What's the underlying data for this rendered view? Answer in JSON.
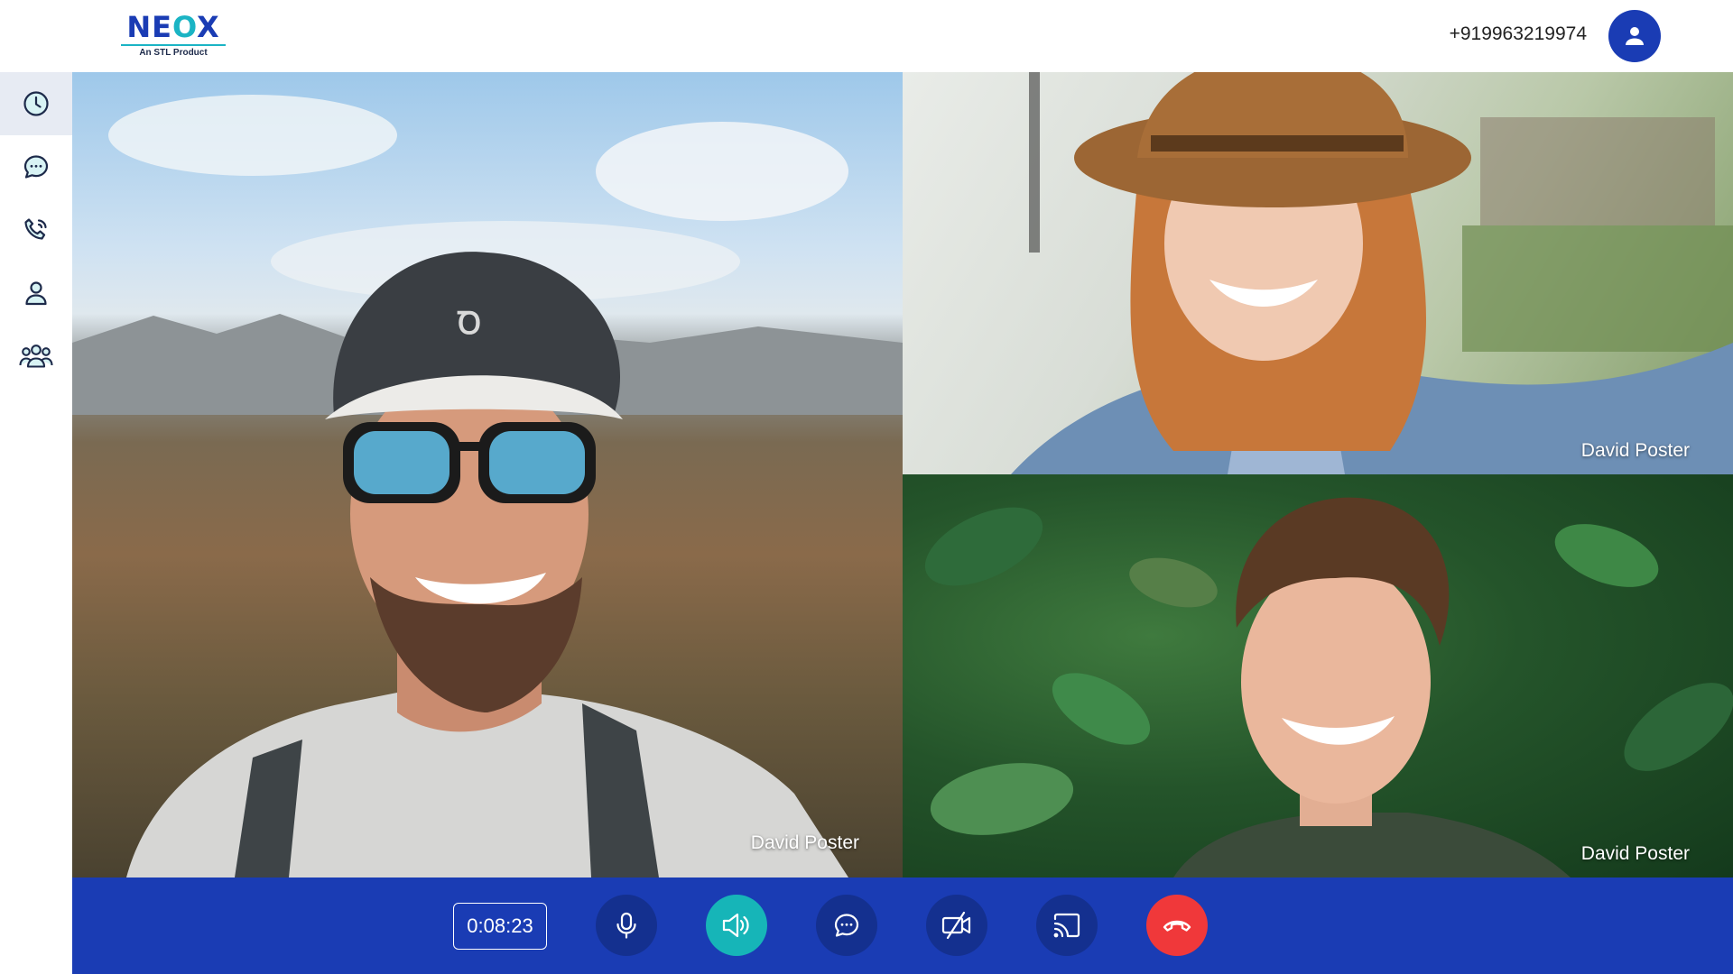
{
  "header": {
    "logo_prefix": "NE",
    "logo_accent": "O",
    "logo_suffix": "X",
    "logo_tagline": "An STL Product",
    "phone_number": "+919963219974",
    "avatar_icon": "user-icon"
  },
  "sidebar": {
    "items": [
      {
        "icon": "clock-icon",
        "active": true
      },
      {
        "icon": "chat-icon",
        "active": false
      },
      {
        "icon": "phone-call-icon",
        "active": false
      },
      {
        "icon": "contact-icon",
        "active": false
      },
      {
        "icon": "group-icon",
        "active": false
      }
    ]
  },
  "participants": [
    {
      "name": "David Poster"
    },
    {
      "name": "David Poster"
    },
    {
      "name": "David Poster"
    }
  ],
  "call_controls": {
    "timer": "0:08:23",
    "buttons": [
      "microphone-icon",
      "speaker-icon",
      "chat-icon",
      "video-off-icon",
      "cast-icon",
      "end-call-icon"
    ]
  },
  "colors": {
    "brand_blue": "#1a3cb4",
    "control_button": "#14308f",
    "accent_teal": "#16b5b8",
    "end_call_red": "#f0383a",
    "sidebar_active_bg": "#e7ebf3"
  }
}
